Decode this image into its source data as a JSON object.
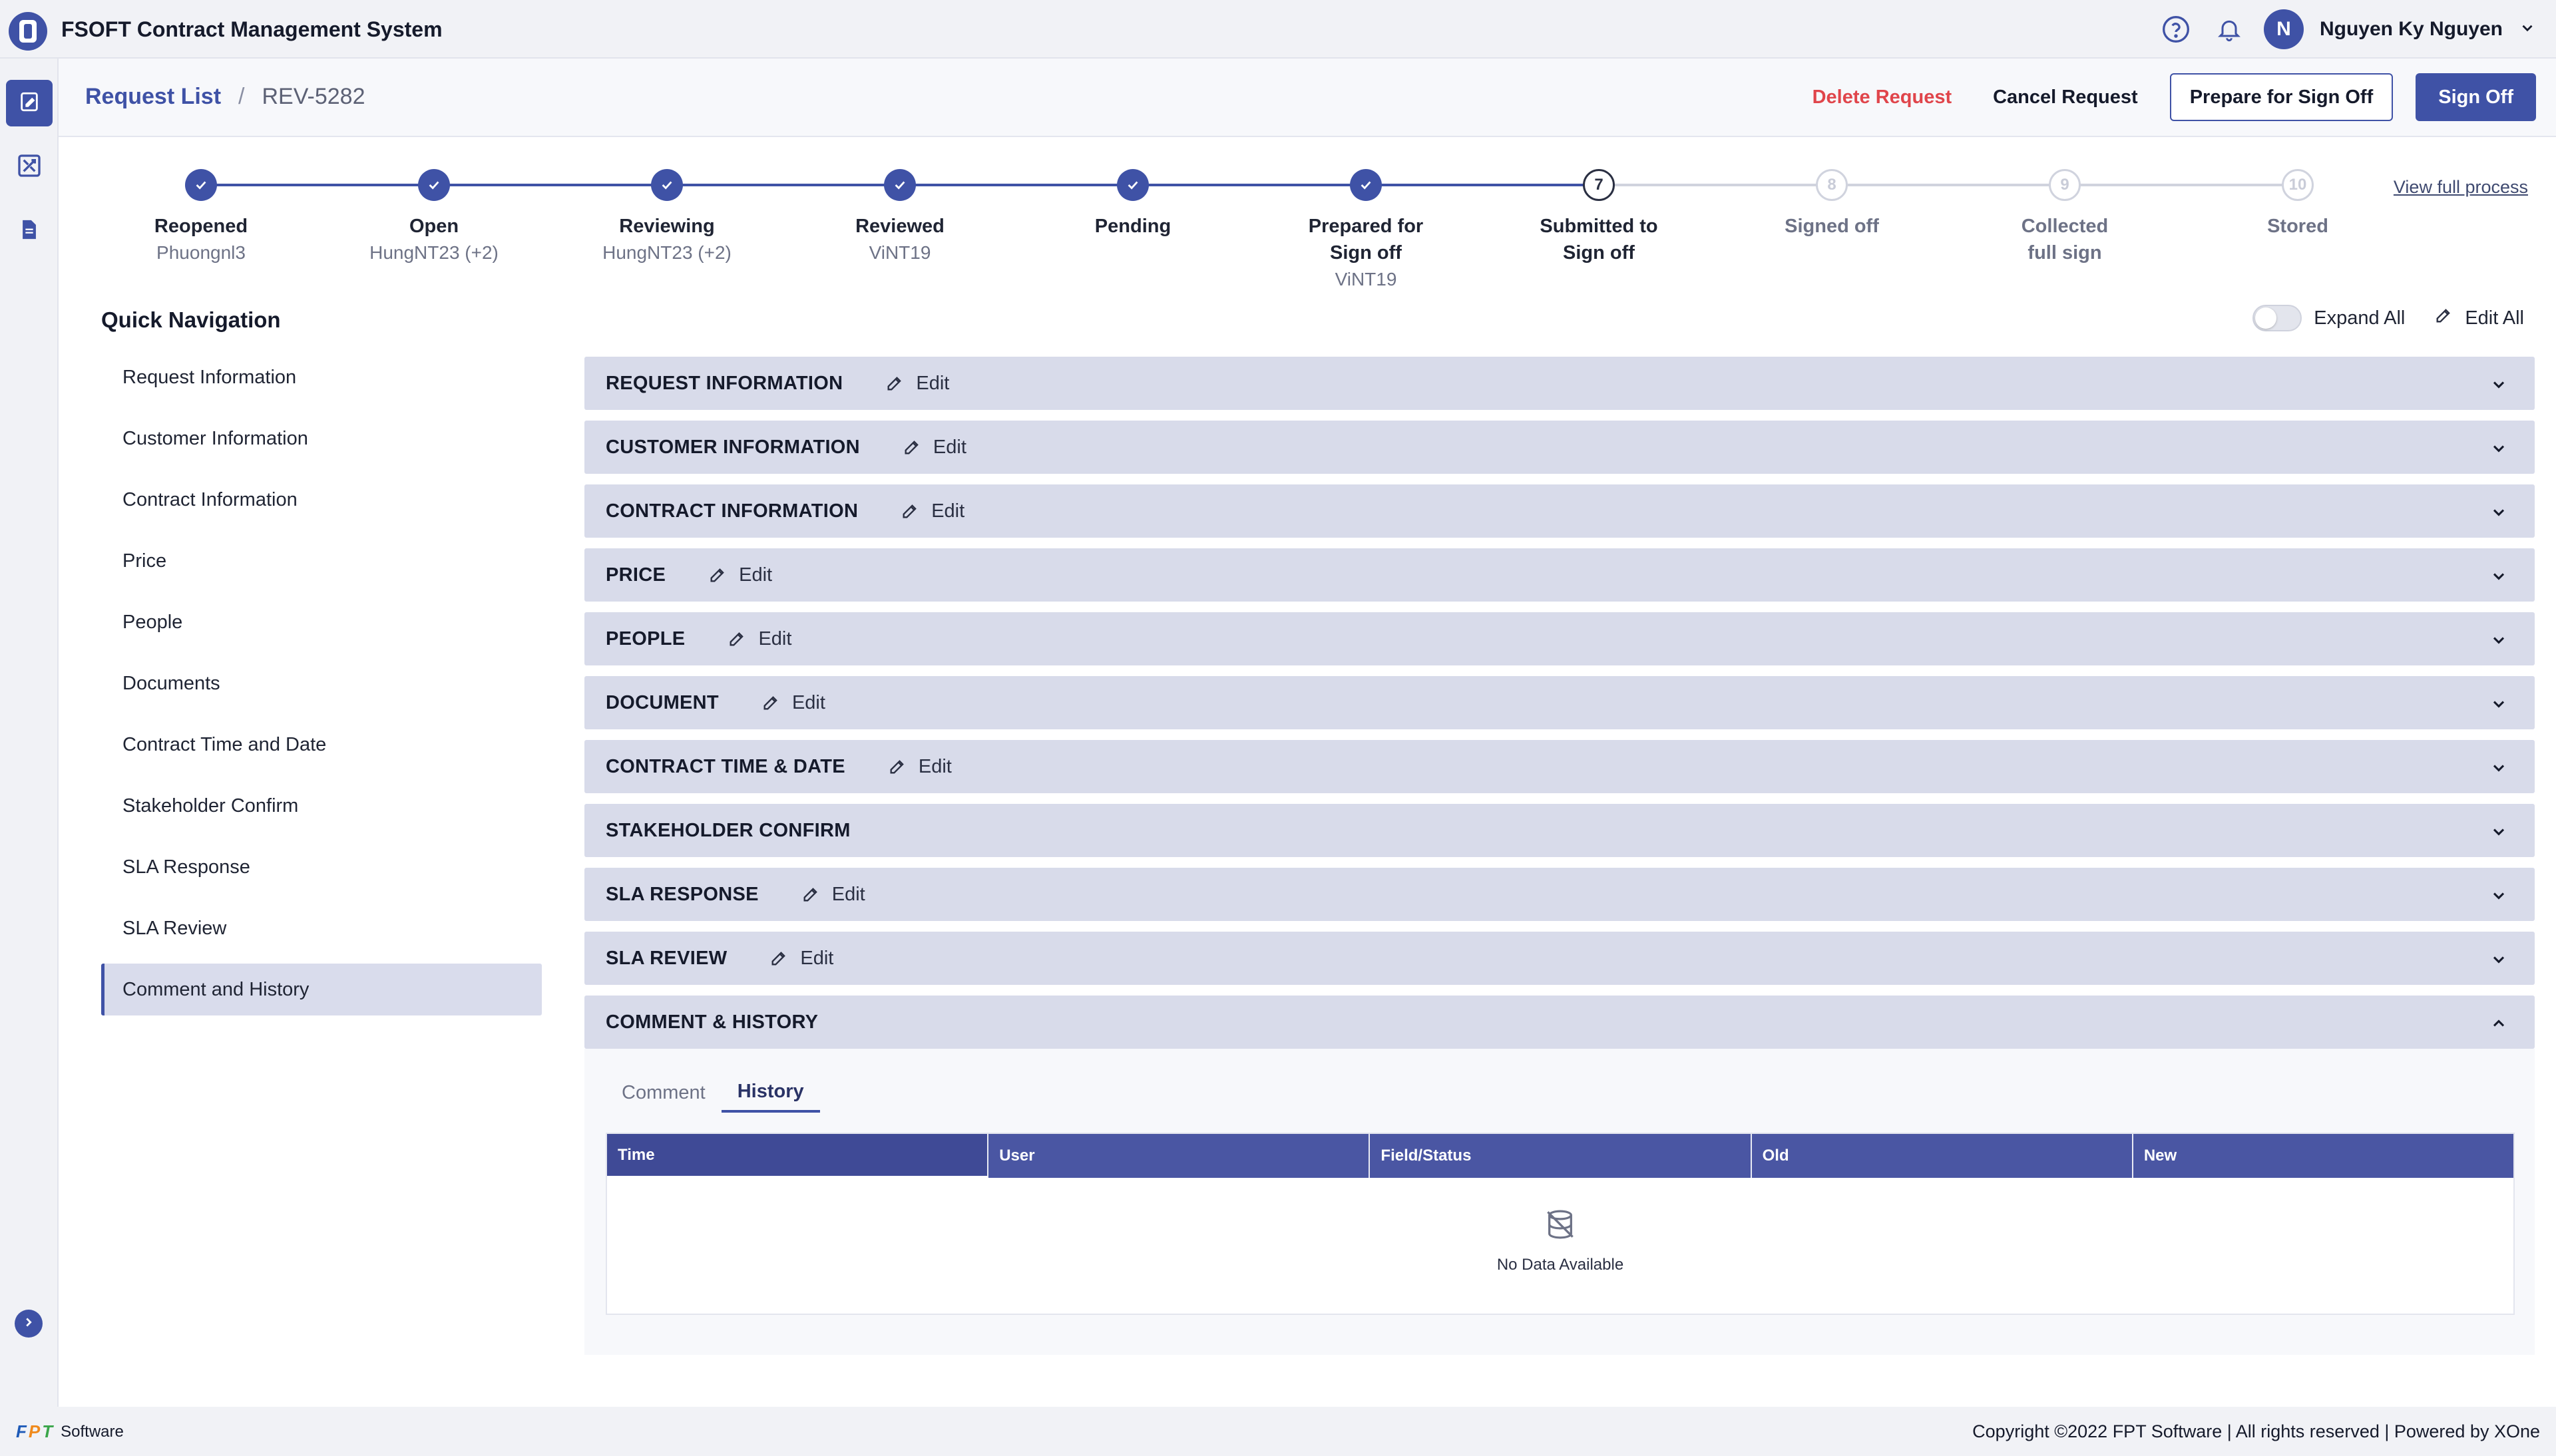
{
  "app": {
    "title": "FSOFT Contract Management System"
  },
  "header": {
    "user_initial": "N",
    "user_name": "Nguyen Ky Nguyen"
  },
  "breadcrumb": {
    "root": "Request List",
    "separator": "/",
    "current": "REV-5282"
  },
  "actions": {
    "delete": "Delete Request",
    "cancel": "Cancel Request",
    "prepare": "Prepare for Sign Off",
    "sign_off": "Sign Off"
  },
  "stepper": {
    "view_full": "View full process",
    "steps": [
      {
        "label": "Reopened",
        "sub": "Phuongnl3",
        "state": "done",
        "number": "1"
      },
      {
        "label": "Open",
        "sub": "HungNT23 (+2)",
        "state": "done",
        "number": "2"
      },
      {
        "label": "Reviewing",
        "sub": "HungNT23 (+2)",
        "state": "done",
        "number": "3"
      },
      {
        "label": "Reviewed",
        "sub": "ViNT19",
        "state": "done",
        "number": "4"
      },
      {
        "label": "Pending",
        "sub": "",
        "state": "done",
        "number": "5"
      },
      {
        "label": "Prepared for Sign off",
        "sub": "ViNT19",
        "state": "done",
        "number": "6"
      },
      {
        "label": "Submitted to Sign off",
        "sub": "",
        "state": "current",
        "number": "7"
      },
      {
        "label": "Signed off",
        "sub": "",
        "state": "future",
        "number": "8"
      },
      {
        "label": "Collected full sign",
        "sub": "",
        "state": "future",
        "number": "9"
      },
      {
        "label": "Stored",
        "sub": "",
        "state": "future",
        "number": "10"
      }
    ]
  },
  "quick_nav": {
    "title": "Quick Navigation",
    "items": [
      "Request Information",
      "Customer Information",
      "Contract Information",
      "Price",
      "People",
      "Documents",
      "Contract Time and Date",
      "Stakeholder Confirm",
      "SLA Response",
      "SLA Review",
      "Comment and History"
    ],
    "active": "Comment and History"
  },
  "toolbar": {
    "expand_all": "Expand All",
    "edit_all": "Edit All"
  },
  "sections": [
    {
      "title": "REQUEST INFORMATION",
      "edit": "Edit"
    },
    {
      "title": "CUSTOMER INFORMATION",
      "edit": "Edit"
    },
    {
      "title": "CONTRACT INFORMATION",
      "edit": "Edit"
    },
    {
      "title": "PRICE",
      "edit": "Edit"
    },
    {
      "title": "PEOPLE",
      "edit": "Edit"
    },
    {
      "title": "DOCUMENT",
      "edit": "Edit"
    },
    {
      "title": "CONTRACT TIME & DATE",
      "edit": "Edit"
    },
    {
      "title": "STAKEHOLDER CONFIRM",
      "edit": ""
    },
    {
      "title": "SLA RESPONSE",
      "edit": "Edit"
    },
    {
      "title": "SLA REVIEW",
      "edit": "Edit"
    },
    {
      "title": "COMMENT & HISTORY",
      "edit": ""
    }
  ],
  "comment_history": {
    "tabs": [
      "Comment",
      "History"
    ],
    "active_tab": "History",
    "columns": [
      "Time",
      "User",
      "Field/Status",
      "Old",
      "New"
    ],
    "empty_text": "No Data Available"
  },
  "footer": {
    "brand_letters": [
      "F",
      "P",
      "T"
    ],
    "brand_text": "Software",
    "copyright": "Copyright ©2022 FPT Software | All rights reserved | Powered by XOne"
  },
  "colors": {
    "primary": "#3f52a6",
    "danger": "#e0454b",
    "section_bg": "#d8dbea",
    "fpt_blue": "#1f5bb8",
    "fpt_orange": "#f08a1c",
    "fpt_green": "#3aa64a"
  }
}
